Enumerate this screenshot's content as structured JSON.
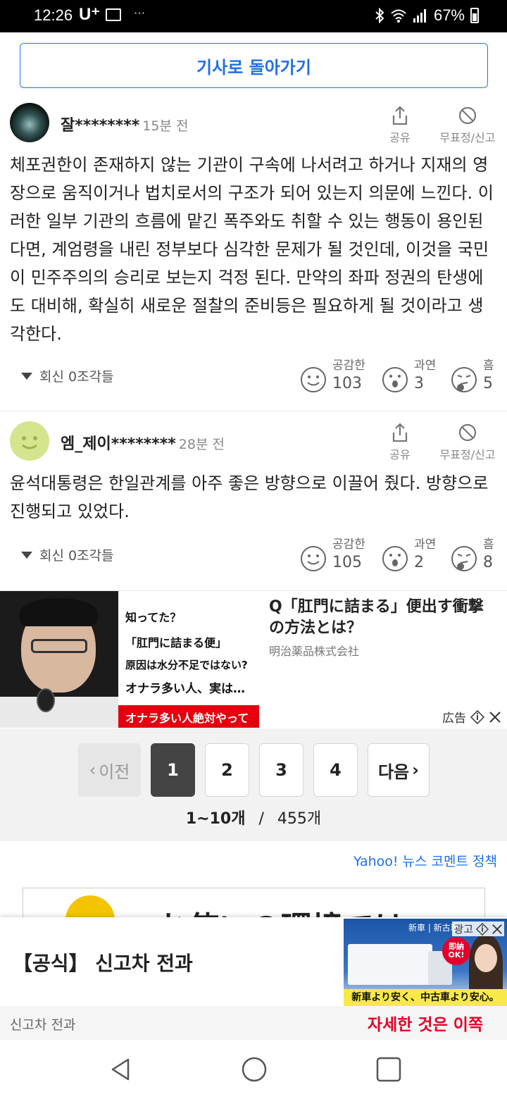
{
  "status": {
    "time": "12:26",
    "carrier": "U⁺",
    "dots": "···",
    "battery": "67%"
  },
  "back_button": "기사로 돌아가기",
  "actions": {
    "share": "공유",
    "report": "무표정/신고"
  },
  "comments": [
    {
      "author": "잘********",
      "time": "15분 전",
      "text": "체포권한이 존재하지 않는 기관이 구속에 나서려고 하거나 지재의 영장으로 움직이거나 법치로서의 구조가 되어 있는지 의문에 느낀다. 이러한 일부 기관의 흐름에 맡긴 폭주와도 취할 수 있는 행동이 용인된다면, 계엄령을 내린 정부보다 심각한 문제가 될 것인데, 이것을 국민이 민주주의의 승리로 보는지 걱정 된다. 만약의 좌파 정권의 탄생에도 대비해, 확실히 새로운 절찰의 준비등은 필요하게 될 것이라고 생각한다.",
      "replies": "회신 0조각들",
      "reactions": [
        {
          "label": "공감한",
          "count": "103"
        },
        {
          "label": "과연",
          "count": "3"
        },
        {
          "label": "흠",
          "count": "5"
        }
      ]
    },
    {
      "author": "엠_제이********",
      "time": "28분 전",
      "text": "윤석대통령은 한일관계를 아주 좋은 방향으로 이끌어 줬다. 방향으로 진행되고 있었다.",
      "replies": "회신 0조각들",
      "reactions": [
        {
          "label": "공감한",
          "count": "105"
        },
        {
          "label": "과연",
          "count": "2"
        },
        {
          "label": "흠",
          "count": "8"
        }
      ]
    }
  ],
  "ad": {
    "img_lines": [
      "知ってた？",
      "「肛門に詰まる便」",
      "原因は水分不足ではない?",
      "オナラ多い人、実は…"
    ],
    "img_banner": "オナラ多い人絶対やって",
    "headline": "Q「肛門に詰まる」便出す衝撃の方法とは？",
    "company": "明治薬品株式会社",
    "label": "広告"
  },
  "pagination": {
    "prev": "이전",
    "pages": [
      "1",
      "2",
      "3",
      "4"
    ],
    "active_page": "1",
    "next": "다음",
    "range": "1~10개",
    "separator": "/",
    "total": "455개"
  },
  "policy_link": "Yahoo! 뉴스 코멘트 정책",
  "peek_banner_text": "お使いの環境では",
  "bottom_ad": {
    "title": "【공식】 신고차 전과",
    "subtitle": "신고차 전과",
    "cta": "자세한 것은 이쪽",
    "label": "광고",
    "image_tag": "新車 | 新古車",
    "image_badge": "即納OK!",
    "image_banner": "新車より安く、中古車より安心。"
  },
  "colors": {
    "accent": "#1f6fe6",
    "cta_red": "#e4002b",
    "ad_red": "#e4000f"
  }
}
